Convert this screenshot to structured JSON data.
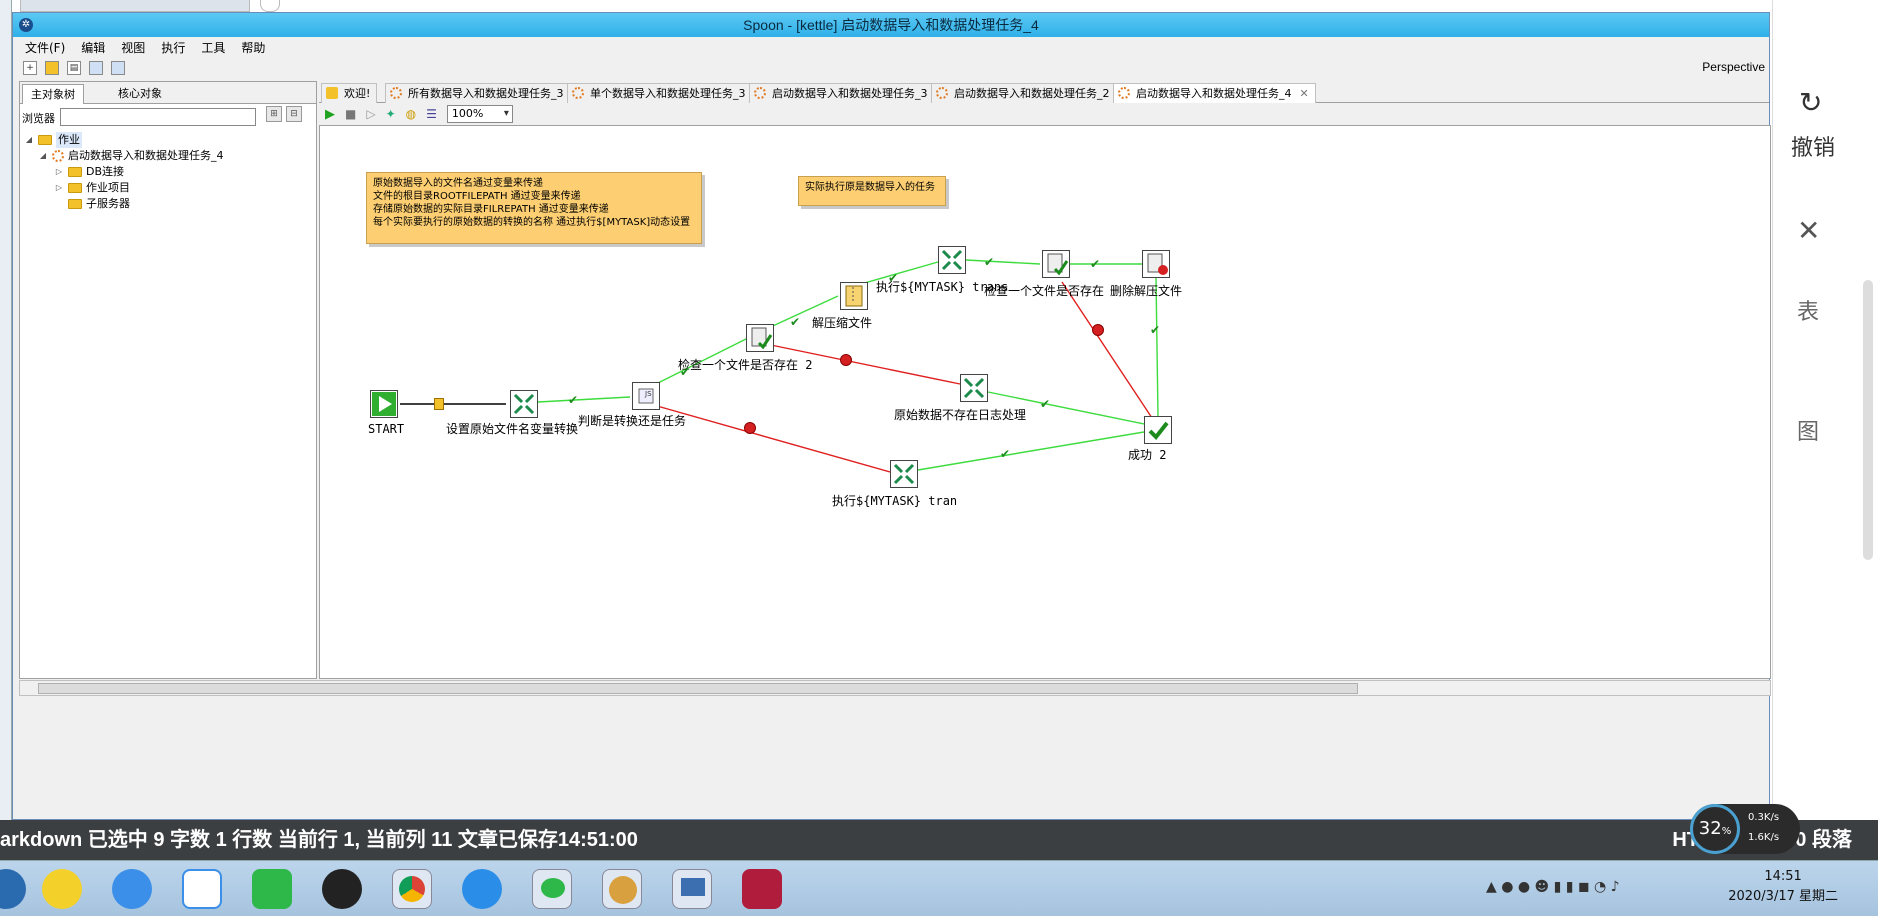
{
  "window": {
    "title": "Spoon - [kettle] 启动数据导入和数据处理任务_4"
  },
  "menu": [
    "文件(F)",
    "编辑",
    "视图",
    "执行",
    "工具",
    "帮助"
  ],
  "perspective": "Perspective",
  "left_panel": {
    "tabs": [
      "主对象树",
      "核心对象"
    ],
    "browser_label": "浏览器",
    "tree": [
      {
        "label": "作业",
        "level": 0
      },
      {
        "label": "启动数据导入和数据处理任务_4",
        "level": 1
      },
      {
        "label": "DB连接",
        "level": 2
      },
      {
        "label": "作业项目",
        "level": 2
      },
      {
        "label": "子服务器",
        "level": 2
      }
    ]
  },
  "editor_tabs": [
    "欢迎!",
    "所有数据导入和数据处理任务_3",
    "单个数据导入和数据处理任务_3",
    "启动数据导入和数据处理任务_3",
    "启动数据导入和数据处理任务_2",
    "启动数据导入和数据处理任务_4"
  ],
  "zoom": "100%",
  "notes": {
    "note1": [
      "原始数据导入的文件名通过变量来传递",
      "文件的根目录ROOTFILEPATH  通过变量来传递",
      "存储原始数据的实际目录FILREPATH 通过变量来传递",
      "每个实际要执行的原始数据的转换的名称 通过执行$[MYTASK]动态设置"
    ],
    "note2": "实际执行原是数据导入的任务"
  },
  "nodes": {
    "start": "START",
    "set_var": "设置原始文件名变量转换",
    "judge": "判断是转换还是任务",
    "check2": "检查一个文件是否存在 2",
    "unzip": "解压缩文件",
    "exec_trans": "执行${MYTASK}  trans",
    "check1": "检查一个文件是否存在",
    "delete": "删除解压文件",
    "log": "原始数据不存在日志处理",
    "exec_tran2": "执行${MYTASK}  tran",
    "success": "成功 2"
  },
  "statusbar": {
    "left": "arkdown 已选中   9 字数   1 行数   当前行 1, 当前列 11   文章已保存14:51:00",
    "right": "HTML  0 字数  0 段落"
  },
  "right_app": {
    "undo": "撤销",
    "item1": "表",
    "item2": "图"
  },
  "speed": {
    "percent": "32",
    "up": "0.3K/s",
    "down": "1.6K/s"
  },
  "clock": {
    "time": "14:51",
    "date": "2020/3/17 星期二"
  }
}
